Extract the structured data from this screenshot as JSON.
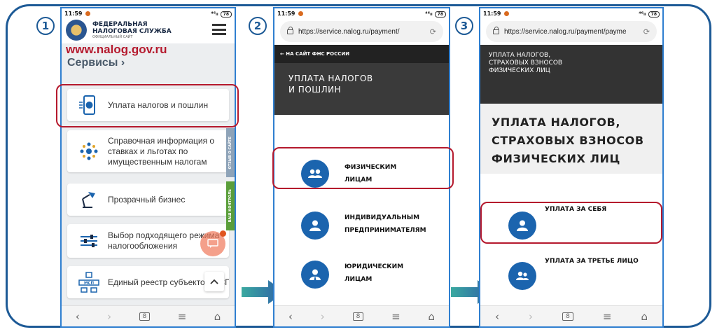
{
  "status": {
    "time": "11:59",
    "signal": "⁴⁶ₗₗ",
    "battery": "78"
  },
  "steps": [
    "1",
    "2",
    "3"
  ],
  "nav": {
    "back": "‹",
    "forward": "›",
    "tabs": "8",
    "menu": "≡",
    "home": "⌂"
  },
  "panel1": {
    "org_line1": "ФЕДЕРАЛЬНАЯ",
    "org_line2": "НАЛОГОВАЯ СЛУЖБА",
    "org_sub": "ОФИЦИАЛЬНЫЙ САЙТ",
    "site_url": "www.nalog.gov.ru",
    "services": "Сервисы",
    "services_chevron": "›",
    "items": [
      {
        "label": "Уплата налогов и пошлин"
      },
      {
        "label": "Справочная информация о ставках и льготах по имущественным налогам"
      },
      {
        "label": "Прозрачный бизнес"
      },
      {
        "label": "Выбор подходящего режима налогообложения"
      },
      {
        "label": "Единый реестр субъектов МСП"
      }
    ],
    "side_tab_feedback": "ОТЗЫВ О САЙТЕ",
    "side_tab_control": "ВАШ КОНТРОЛЬ",
    "icon_msp": "МСП"
  },
  "panel2": {
    "url": "https://service.nalog.ru/payment/",
    "back_link": "← НА САЙТ ФНС РОССИИ",
    "title_line1": "УПЛАТА НАЛОГОВ",
    "title_line2": "И ПОШЛИН",
    "options": [
      {
        "line1": "ФИЗИЧЕСКИМ",
        "line2": "ЛИЦАМ"
      },
      {
        "line1": "ИНДИВИДУАЛЬНЫМ",
        "line2": "ПРЕДПРИНИМАТЕЛЯМ"
      },
      {
        "line1": "ЮРИДИЧЕСКИМ",
        "line2": "ЛИЦАМ"
      }
    ]
  },
  "panel3": {
    "url": "https://service.nalog.ru/payment/payme",
    "small_title_1": "УПЛАТА НАЛОГОВ,",
    "small_title_2": "СТРАХОВЫХ ВЗНОСОВ",
    "small_title_3": "ФИЗИЧЕСКИХ ЛИЦ",
    "big_title_1": "УПЛАТА НАЛОГОВ,",
    "big_title_2": "СТРАХОВЫХ ВЗНОСОВ",
    "big_title_3": "ФИЗИЧЕСКИХ ЛИЦ",
    "options": [
      {
        "label": "УПЛАТА ЗА СЕБЯ"
      },
      {
        "label": "УПЛАТА ЗА ТРЕТЬЕ ЛИЦО"
      }
    ]
  },
  "colors": {
    "frame": "#1d5a96",
    "highlight": "#b5192d",
    "brand_blue": "#1b64ae",
    "dark_header": "#333333",
    "site_url": "#b5192d"
  }
}
